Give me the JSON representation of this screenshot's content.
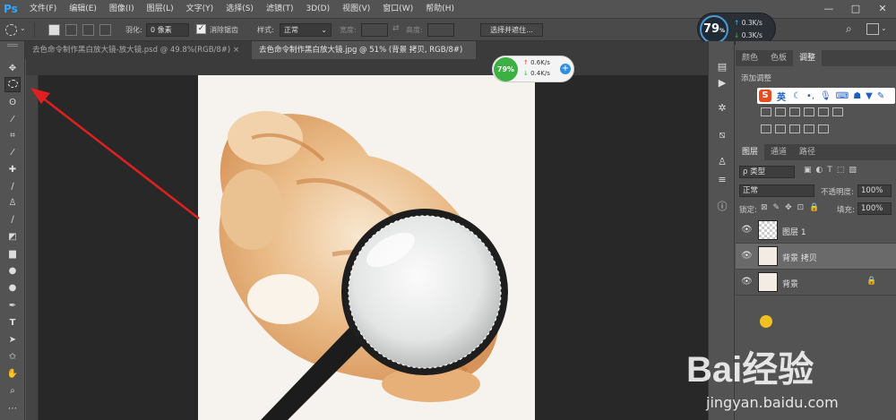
{
  "app": {
    "logo": "Ps"
  },
  "menu": [
    "文件(F)",
    "编辑(E)",
    "图像(I)",
    "图层(L)",
    "文字(Y)",
    "选择(S)",
    "滤镜(T)",
    "3D(D)",
    "视图(V)",
    "窗口(W)",
    "帮助(H)"
  ],
  "window_controls": [
    "—",
    "□",
    "✕"
  ],
  "options": {
    "feather_label": "羽化:",
    "feather_value": "0 像素",
    "antialias_label": "消除锯齿",
    "style_label": "样式:",
    "style_value": "正常",
    "width_label": "宽度:",
    "height_label": "高度:",
    "select_mask_button": "选择并遮住..."
  },
  "tabs": [
    {
      "label": "去色命令制作黑白放大镜-放大镜.psd @ 49.8%(RGB/8#)",
      "close": "×"
    },
    {
      "label": "去色命令制作黑白放大镜.jpg @ 51% (背景 拷贝, RGB/8#) *",
      "close": "×"
    }
  ],
  "speed_widget_top": {
    "percent": "79",
    "percent_suffix": "%",
    "up": "0.3K/s",
    "down": "0.3K/s"
  },
  "speed_widget_canvas": {
    "percent": "79%",
    "up": "0.6K/s",
    "down": "0.4K/s",
    "plus": "+"
  },
  "panels": {
    "top_tabs": [
      "颜色",
      "色板",
      "调整"
    ],
    "adjust_title": "添加调整",
    "layer_tabs": [
      "图层",
      "通道",
      "路径"
    ],
    "filter_kind": "ρ 类型",
    "blend_mode": "正常",
    "opacity_label": "不透明度:",
    "opacity_value": "100%",
    "lock_label": "锁定:",
    "fill_label": "填充:",
    "fill_value": "100%",
    "layers": [
      {
        "name": "图层 1",
        "selected": false
      },
      {
        "name": "背景 拷贝",
        "selected": true
      },
      {
        "name": "背景",
        "selected": false
      }
    ]
  },
  "ime_toolbar": {
    "logo": "S",
    "lang": "英"
  },
  "watermark": {
    "brand": "Bai经验",
    "url": "jingyan.baidu.com"
  },
  "colors": {
    "accent": "#31a8ff",
    "annotation_arrow": "#e02020",
    "gauge_green": "#3cb043"
  }
}
